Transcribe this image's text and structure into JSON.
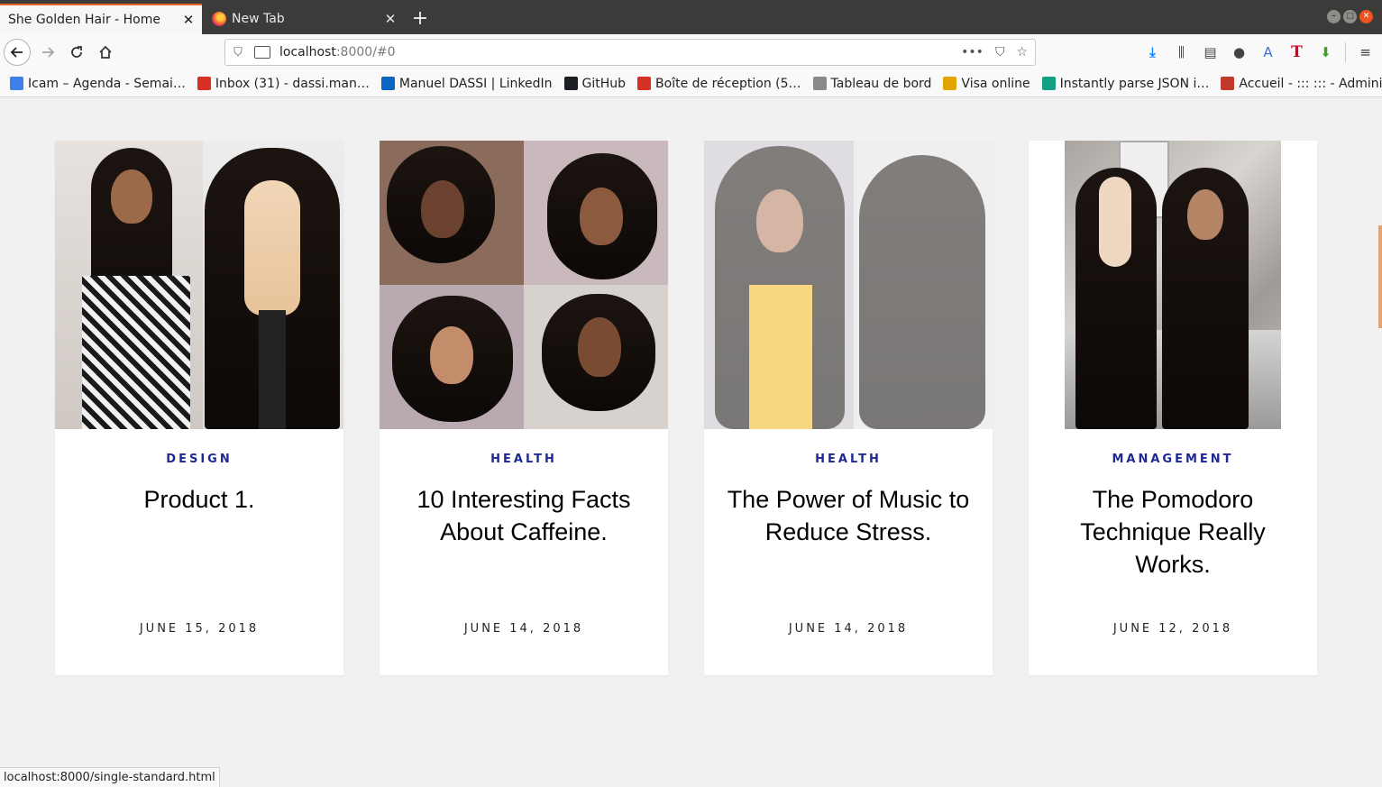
{
  "browser": {
    "tabs": [
      {
        "title": "She Golden Hair - Home",
        "active": true
      },
      {
        "title": "New Tab",
        "active": false
      }
    ],
    "url_host": "localhost",
    "url_rest": ":8000/#0",
    "bookmarks": [
      {
        "label": "Icam – Agenda - Semai…",
        "icon": "calendar-icon",
        "color": "#3f7fe8"
      },
      {
        "label": "Inbox (31) - dassi.man…",
        "icon": "gmail-icon",
        "color": "#d93025"
      },
      {
        "label": "Manuel DASSI | LinkedIn",
        "icon": "linkedin-icon",
        "color": "#0a66c2"
      },
      {
        "label": "GitHub",
        "icon": "github-icon",
        "color": "#1b1f23"
      },
      {
        "label": "Boîte de réception (5…",
        "icon": "gmail-icon",
        "color": "#d93025"
      },
      {
        "label": "Tableau de bord",
        "icon": "dashboard-icon",
        "color": "#8a8a8a"
      },
      {
        "label": "Visa online",
        "icon": "visa-icon",
        "color": "#e2a500"
      },
      {
        "label": "Instantly parse JSON i…",
        "icon": "quicktype-icon",
        "color": "#14a085"
      },
      {
        "label": "Accueil - ::: ::: - Admini…",
        "icon": "admin-icon",
        "color": "#c0392b"
      }
    ],
    "status_url": "localhost:8000/single-standard.html"
  },
  "cards": [
    {
      "category": "DESIGN",
      "title": "Product 1.",
      "date": "JUNE 15, 2018"
    },
    {
      "category": "HEALTH",
      "title": "10 Interesting Facts About Caffeine.",
      "date": "JUNE 14, 2018"
    },
    {
      "category": "HEALTH",
      "title": "The Power of Music to Reduce Stress.",
      "date": "JUNE 14, 2018"
    },
    {
      "category": "MANAGEMENT",
      "title": "The Pomodoro Technique Really Works.",
      "date": "JUNE 12, 2018"
    }
  ],
  "colors": {
    "category": "#1d2a94",
    "tab_accent": "#e66221"
  }
}
